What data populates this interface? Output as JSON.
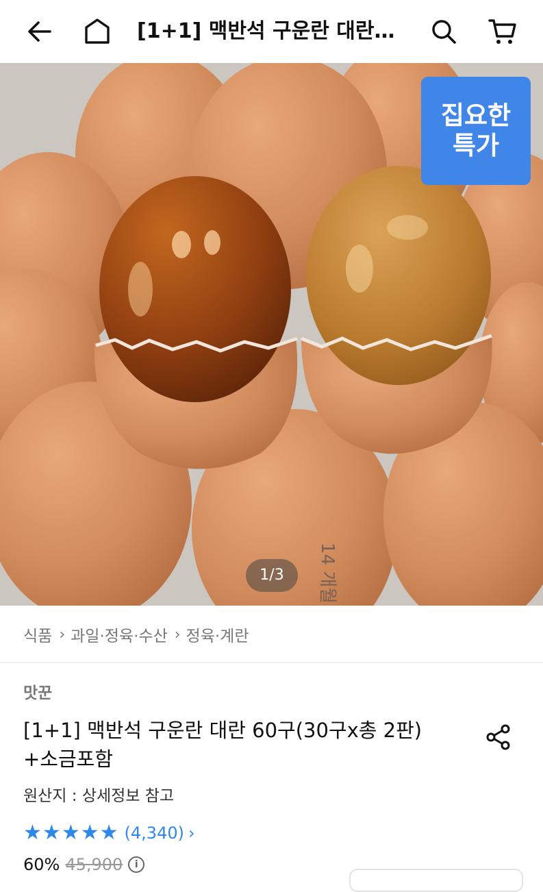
{
  "header": {
    "title": "[1+1] 맥반석 구운란 대란 6...",
    "back_icon": "back-arrow-icon",
    "home_icon": "home-icon",
    "search_icon": "search-icon",
    "cart_icon": "cart-icon"
  },
  "hero": {
    "badge_line1": "집요한",
    "badge_line2": "특가",
    "badge_color": "#3f86e8",
    "image_counter": "1/3"
  },
  "breadcrumb": [
    "식품",
    "과일·정육·수산",
    "정육·계란"
  ],
  "product": {
    "seller": "맛꾼",
    "title": "[1+1] 맥반석 구운란 대란 60구(30구x총 2판) +소금포함",
    "origin": "원산지 : 상세정보 참고",
    "rating": 5,
    "review_count": "(4,340)",
    "discount": "60%",
    "original_price": "45,900"
  },
  "colors": {
    "accent": "#2e88e8"
  }
}
